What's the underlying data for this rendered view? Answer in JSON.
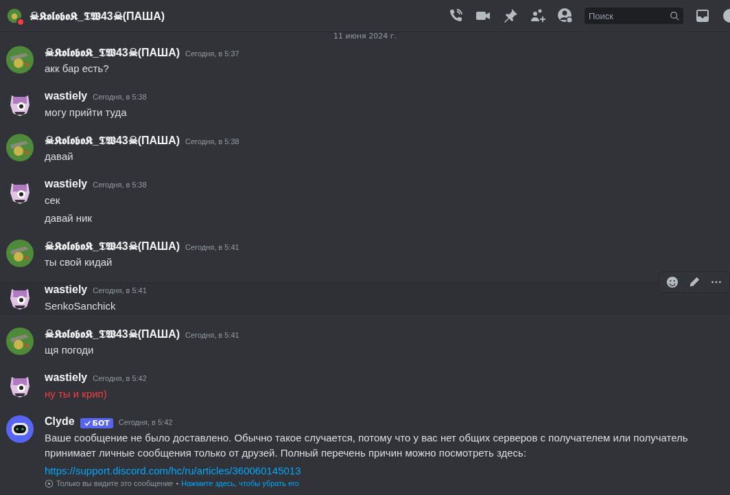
{
  "header": {
    "title": "☠𝕶𝖔𝖑𝖔𝖇𝖔𝕶_𝕿𝖂43☠(ПАША)",
    "dnd": true,
    "search_placeholder": "Поиск"
  },
  "date_divider": "11 июня 2024 г.",
  "messages": [
    {
      "author": "☠𝕶𝖔𝖑𝖔𝖇𝖔𝕶_𝕿𝖂43☠(ПАША)",
      "kind": "kolobok",
      "time": "Сегодня, в 5:37",
      "lines": [
        "акк бар есть?"
      ],
      "hovered": false,
      "failed": false
    },
    {
      "author": "wastiely",
      "kind": "wastiely",
      "time": "Сегодня, в 5:38",
      "lines": [
        "могу прийти туда"
      ],
      "hovered": false,
      "failed": false
    },
    {
      "author": "☠𝕶𝖔𝖑𝖔𝖇𝖔𝕶_𝕿𝖂43☠(ПАША)",
      "kind": "kolobok",
      "time": "Сегодня, в 5:38",
      "lines": [
        "давай"
      ],
      "hovered": false,
      "failed": false
    },
    {
      "author": "wastiely",
      "kind": "wastiely",
      "time": "Сегодня, в 5:38",
      "lines": [
        "сек",
        "давай ник"
      ],
      "hovered": false,
      "failed": false
    },
    {
      "author": "☠𝕶𝖔𝖑𝖔𝖇𝖔𝕶_𝕿𝖂43☠(ПАША)",
      "kind": "kolobok",
      "time": "Сегодня, в 5:41",
      "lines": [
        "ты свой кидай"
      ],
      "hovered": false,
      "failed": false
    },
    {
      "author": "wastiely",
      "kind": "wastiely",
      "time": "Сегодня, в 5:41",
      "lines": [
        "SenkoSanchick"
      ],
      "hovered": true,
      "failed": false
    },
    {
      "author": "☠𝕶𝖔𝖑𝖔𝖇𝖔𝕶_𝕿𝖂43☠(ПАША)",
      "kind": "kolobok",
      "time": "Сегодня, в 5:41",
      "lines": [
        "щя погоди"
      ],
      "hovered": false,
      "failed": false
    },
    {
      "author": "wastiely",
      "kind": "wastiely",
      "time": "Сегодня, в 5:42",
      "lines": [
        "ну ты и крип)"
      ],
      "hovered": false,
      "failed": true
    }
  ],
  "bot_message": {
    "author": "Clyde",
    "badge": "БОТ",
    "time": "Сегодня, в 5:42",
    "text": "Ваше сообщение не было доставлено. Обычно такое случается, потому что у вас нет общих серверов с получателем или получатель принимает личные сообщения только от друзей. Полный перечень причин можно посмотреть здесь:",
    "link": "https://support.discord.com/hc/ru/articles/360060145013",
    "notice": "Только вы видите это сообщение",
    "separator": "•",
    "dismiss": "Нажмите здесь, чтобы убрать его"
  }
}
